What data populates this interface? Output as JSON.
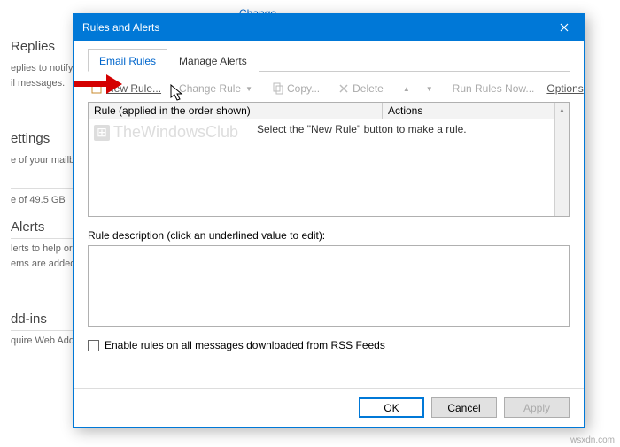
{
  "bg": {
    "change_link": "Change",
    "replies": {
      "heading": "Replies",
      "l1": "eplies to notify o",
      "l2": "il messages."
    },
    "settings": {
      "heading": "ettings",
      "l1": "e of your mailbox"
    },
    "quota": {
      "l1": "e of 49.5 GB"
    },
    "alerts": {
      "heading": "Alerts",
      "l1": "lerts to help orga",
      "l2": "ems are added, o"
    },
    "addins": {
      "heading": "dd-ins",
      "l1": "quire Web Add-i"
    }
  },
  "dialog": {
    "title": "Rules and Alerts",
    "tabs": {
      "email": "Email Rules",
      "manage": "Manage Alerts"
    },
    "toolbar": {
      "new_rule": "New Rule...",
      "change_rule": "Change Rule",
      "copy": "Copy...",
      "delete": "Delete",
      "run_now": "Run Rules Now...",
      "options": "Options"
    },
    "list": {
      "col_rule": "Rule (applied in the order shown)",
      "col_actions": "Actions",
      "hint": "Select the \"New Rule\" button to make a rule.",
      "watermark": "TheWindowsClub"
    },
    "desc_label": "Rule description (click an underlined value to edit):",
    "rss_label": "Enable rules on all messages downloaded from RSS Feeds",
    "buttons": {
      "ok": "OK",
      "cancel": "Cancel",
      "apply": "Apply"
    }
  },
  "credit": "wsxdn.com"
}
